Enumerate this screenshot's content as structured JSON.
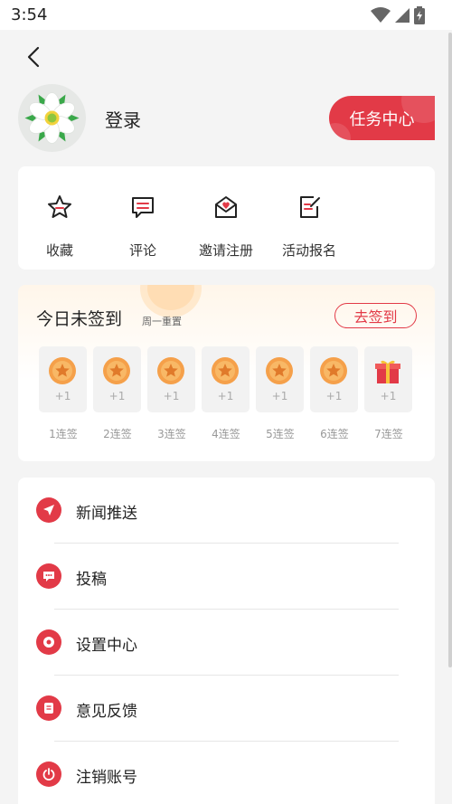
{
  "status": {
    "time": "3:54",
    "icons": [
      "wifi-icon",
      "signal-icon",
      "battery-icon"
    ]
  },
  "header": {
    "back_icon": "chevron-left-icon",
    "avatar_icon": "flower-avatar",
    "login_label": "登录",
    "task_center_label": "任务中心"
  },
  "quick_actions": [
    {
      "label": "收藏",
      "icon": "star-icon"
    },
    {
      "label": "评论",
      "icon": "comment-icon"
    },
    {
      "label": "邀请注册",
      "icon": "invite-icon"
    },
    {
      "label": "活动报名",
      "icon": "signup-icon"
    }
  ],
  "signin": {
    "title": "今日未签到",
    "subtitle": "周一重置",
    "button_label": "去签到",
    "days": [
      {
        "reward": "+1",
        "label": "1连签",
        "icon": "coin-icon"
      },
      {
        "reward": "+1",
        "label": "2连签",
        "icon": "coin-icon"
      },
      {
        "reward": "+1",
        "label": "3连签",
        "icon": "coin-icon"
      },
      {
        "reward": "+1",
        "label": "4连签",
        "icon": "coin-icon"
      },
      {
        "reward": "+1",
        "label": "5连签",
        "icon": "coin-icon"
      },
      {
        "reward": "+1",
        "label": "6连签",
        "icon": "coin-icon"
      },
      {
        "reward": "+1",
        "label": "7连签",
        "icon": "gift-icon"
      }
    ]
  },
  "menu": [
    {
      "label": "新闻推送",
      "icon": "send-icon"
    },
    {
      "label": "投稿",
      "icon": "message-icon"
    },
    {
      "label": "设置中心",
      "icon": "settings-icon"
    },
    {
      "label": "意见反馈",
      "icon": "feedback-icon"
    },
    {
      "label": "注销账号",
      "icon": "power-icon"
    }
  ],
  "colors": {
    "accent": "#e23a47",
    "background": "#f4f4f4",
    "card": "#ffffff",
    "coin": "#f5a04a"
  }
}
